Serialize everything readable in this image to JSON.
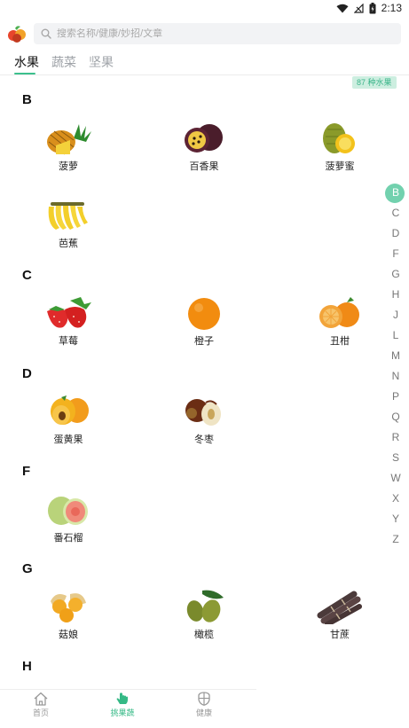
{
  "status_bar": {
    "time": "2:13"
  },
  "search": {
    "placeholder": "搜索名称/健康/妙招/文章"
  },
  "tabs": [
    {
      "label": "水果"
    },
    {
      "label": "蔬菜"
    },
    {
      "label": "坚果"
    }
  ],
  "count_badge": "87 种水果",
  "sections": [
    {
      "letter": "B",
      "items": [
        {
          "name": "菠萝",
          "icon": "pineapple-icon"
        },
        {
          "name": "百香果",
          "icon": "passion-fruit-icon"
        },
        {
          "name": "菠萝蜜",
          "icon": "jackfruit-icon"
        },
        {
          "name": "芭蕉",
          "icon": "plantain-icon"
        }
      ]
    },
    {
      "letter": "C",
      "items": [
        {
          "name": "草莓",
          "icon": "strawberry-icon"
        },
        {
          "name": "橙子",
          "icon": "orange-icon"
        },
        {
          "name": "丑柑",
          "icon": "ugly-orange-icon"
        }
      ]
    },
    {
      "letter": "D",
      "items": [
        {
          "name": "蛋黄果",
          "icon": "egg-fruit-icon"
        },
        {
          "name": "冬枣",
          "icon": "winter-jujube-icon"
        }
      ]
    },
    {
      "letter": "F",
      "items": [
        {
          "name": "番石榴",
          "icon": "guava-icon"
        }
      ]
    },
    {
      "letter": "G",
      "items": [
        {
          "name": "菇娘",
          "icon": "ground-cherry-icon"
        },
        {
          "name": "橄榄",
          "icon": "olive-icon"
        },
        {
          "name": "甘蔗",
          "icon": "sugarcane-icon"
        }
      ]
    },
    {
      "letter": "H",
      "items": []
    }
  ],
  "index_letters": [
    "B",
    "C",
    "D",
    "F",
    "G",
    "H",
    "J",
    "L",
    "M",
    "N",
    "P",
    "Q",
    "R",
    "S",
    "W",
    "X",
    "Y",
    "Z"
  ],
  "index_active": "B",
  "bottom_nav": [
    {
      "label": "首页",
      "icon": "home-icon"
    },
    {
      "label": "挑果蔬",
      "icon": "hand-pick-icon"
    },
    {
      "label": "健康",
      "icon": "shield-icon"
    }
  ],
  "colors": {
    "accent": "#3cc08d",
    "badge_bg": "#cdeee0",
    "index_active": "#72d1ae"
  }
}
